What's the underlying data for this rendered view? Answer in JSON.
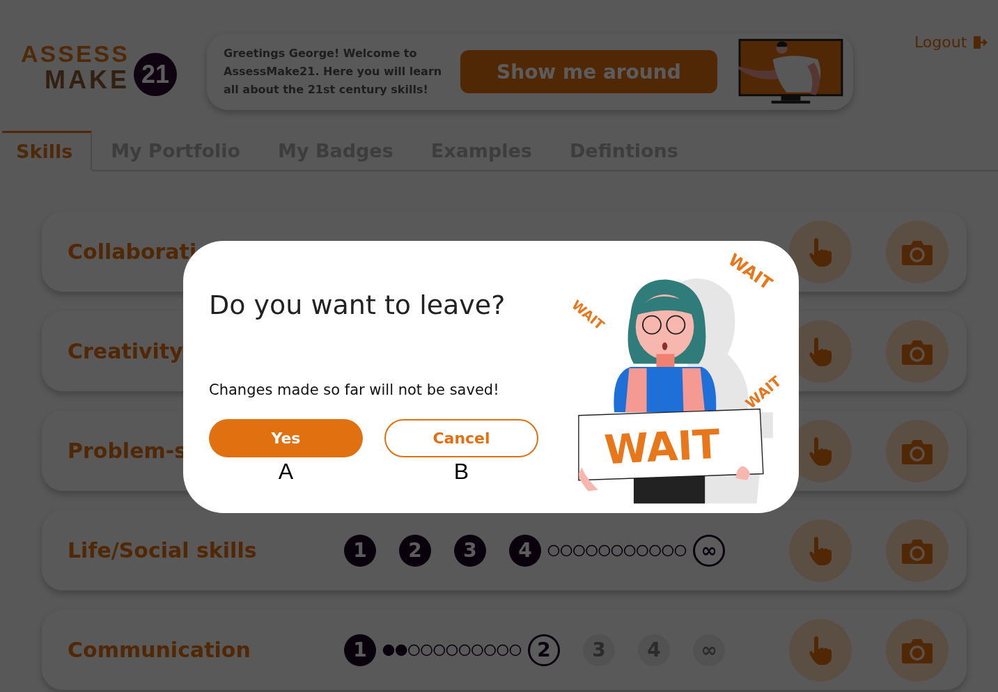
{
  "logo": {
    "top": "ASSESS",
    "bottom": "MAKE",
    "badge": "21"
  },
  "banner": {
    "text": "Greetings George! Welcome to AssessMake21. Here you will learn all about the 21st century skills!",
    "button": "Show me around"
  },
  "logout": "Logout",
  "tabs": [
    {
      "label": "Skills",
      "selected": true
    },
    {
      "label": "My Portfolio",
      "selected": false
    },
    {
      "label": "My Badges",
      "selected": false
    },
    {
      "label": "Examples",
      "selected": false
    },
    {
      "label": "Defintions",
      "selected": false
    }
  ],
  "skills": [
    {
      "name": "Collaborati"
    },
    {
      "name": "Creativity"
    },
    {
      "name": "Problem-s"
    },
    {
      "name": "Life/Social skills",
      "progress": [
        {
          "kind": "step",
          "label": "1",
          "completed": true,
          "locked": false
        },
        {
          "kind": "step",
          "label": "2",
          "completed": true,
          "locked": false
        },
        {
          "kind": "step",
          "label": "3",
          "completed": true,
          "locked": false
        },
        {
          "kind": "step",
          "label": "4",
          "completed": true,
          "locked": false
        },
        {
          "kind": "dots",
          "dots": [
            {
              "filled": false
            },
            {
              "filled": false
            },
            {
              "filled": false
            },
            {
              "filled": false
            },
            {
              "filled": false
            },
            {
              "filled": false
            },
            {
              "filled": false
            },
            {
              "filled": false
            },
            {
              "filled": false
            },
            {
              "filled": false
            },
            {
              "filled": false
            }
          ]
        },
        {
          "kind": "step",
          "label": "∞",
          "completed": false,
          "locked": false
        }
      ]
    },
    {
      "name": "Communication",
      "progress": [
        {
          "kind": "step",
          "label": "1",
          "completed": true,
          "locked": false
        },
        {
          "kind": "dots",
          "dots": [
            {
              "filled": true
            },
            {
              "filled": true
            },
            {
              "filled": false
            },
            {
              "filled": false
            },
            {
              "filled": false
            },
            {
              "filled": false
            },
            {
              "filled": false
            },
            {
              "filled": false
            },
            {
              "filled": false
            },
            {
              "filled": false
            },
            {
              "filled": false
            }
          ]
        },
        {
          "kind": "step",
          "label": "2",
          "completed": false,
          "locked": false
        },
        {
          "kind": "step",
          "label": "3",
          "completed": false,
          "locked": true
        },
        {
          "kind": "step",
          "label": "4",
          "completed": false,
          "locked": true
        },
        {
          "kind": "step",
          "label": "∞",
          "completed": false,
          "locked": true
        }
      ]
    }
  ],
  "dialog": {
    "title": "Do you want to leave?",
    "message": "Changes made so far will not be saved!",
    "buttons": [
      {
        "label": "Yes",
        "kind": "primary",
        "marker": "A"
      },
      {
        "label": "Cancel",
        "kind": "secondary",
        "marker": "B"
      }
    ],
    "illustration_texts": [
      "WAIT",
      "WAIT",
      "WAIT",
      "WAIT"
    ]
  }
}
